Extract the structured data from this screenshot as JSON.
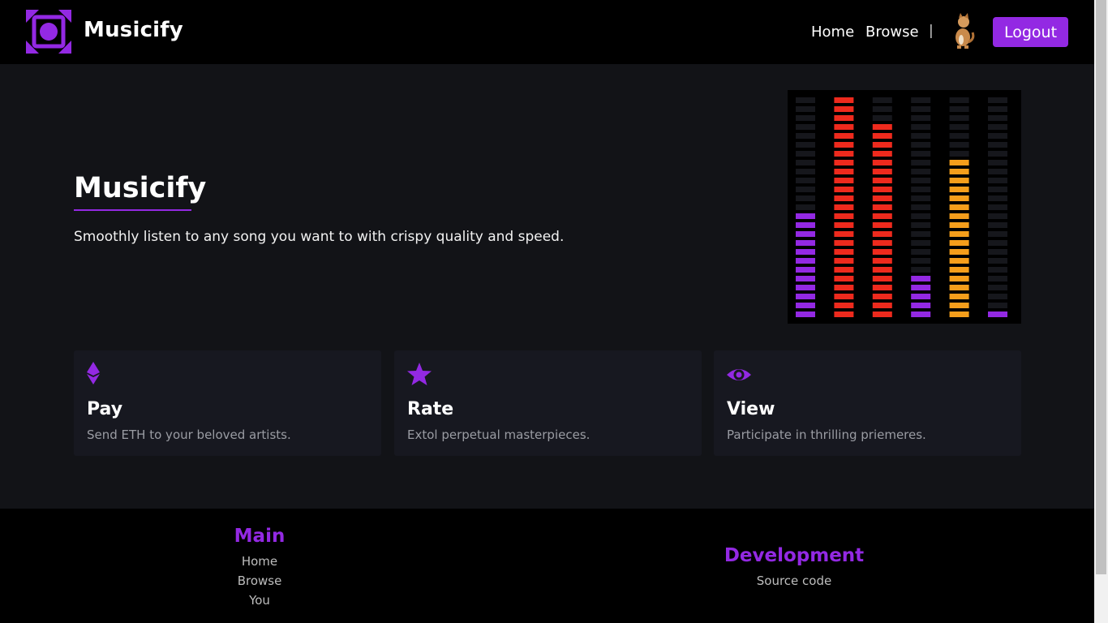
{
  "header": {
    "brand": "Musicify",
    "nav": {
      "home": "Home",
      "browse": "Browse",
      "separator": "|"
    },
    "logout_label": "Logout",
    "accent_color": "#9329e3"
  },
  "hero": {
    "title": "Musicify",
    "subtitle": "Smoothly listen to any song you want to with crispy quality and speed."
  },
  "equalizer": {
    "colors": [
      "#9329e3",
      "#ee2a1d",
      "#ee2a1d",
      "#9329e3",
      "#f59e1b",
      "#9329e3"
    ],
    "levels": [
      0.47,
      1.0,
      0.86,
      0.18,
      0.71,
      0.05
    ]
  },
  "features": [
    {
      "icon": "ethereum-icon",
      "title": "Pay",
      "description": "Send ETH to your beloved artists."
    },
    {
      "icon": "star-icon",
      "title": "Rate",
      "description": "Extol perpetual masterpieces."
    },
    {
      "icon": "eye-icon",
      "title": "View",
      "description": "Participate in thrilling priemeres."
    }
  ],
  "footer": {
    "main": {
      "heading": "Main",
      "links": [
        "Home",
        "Browse",
        "You"
      ]
    },
    "development": {
      "heading": "Development",
      "links": [
        "Source code"
      ]
    }
  }
}
